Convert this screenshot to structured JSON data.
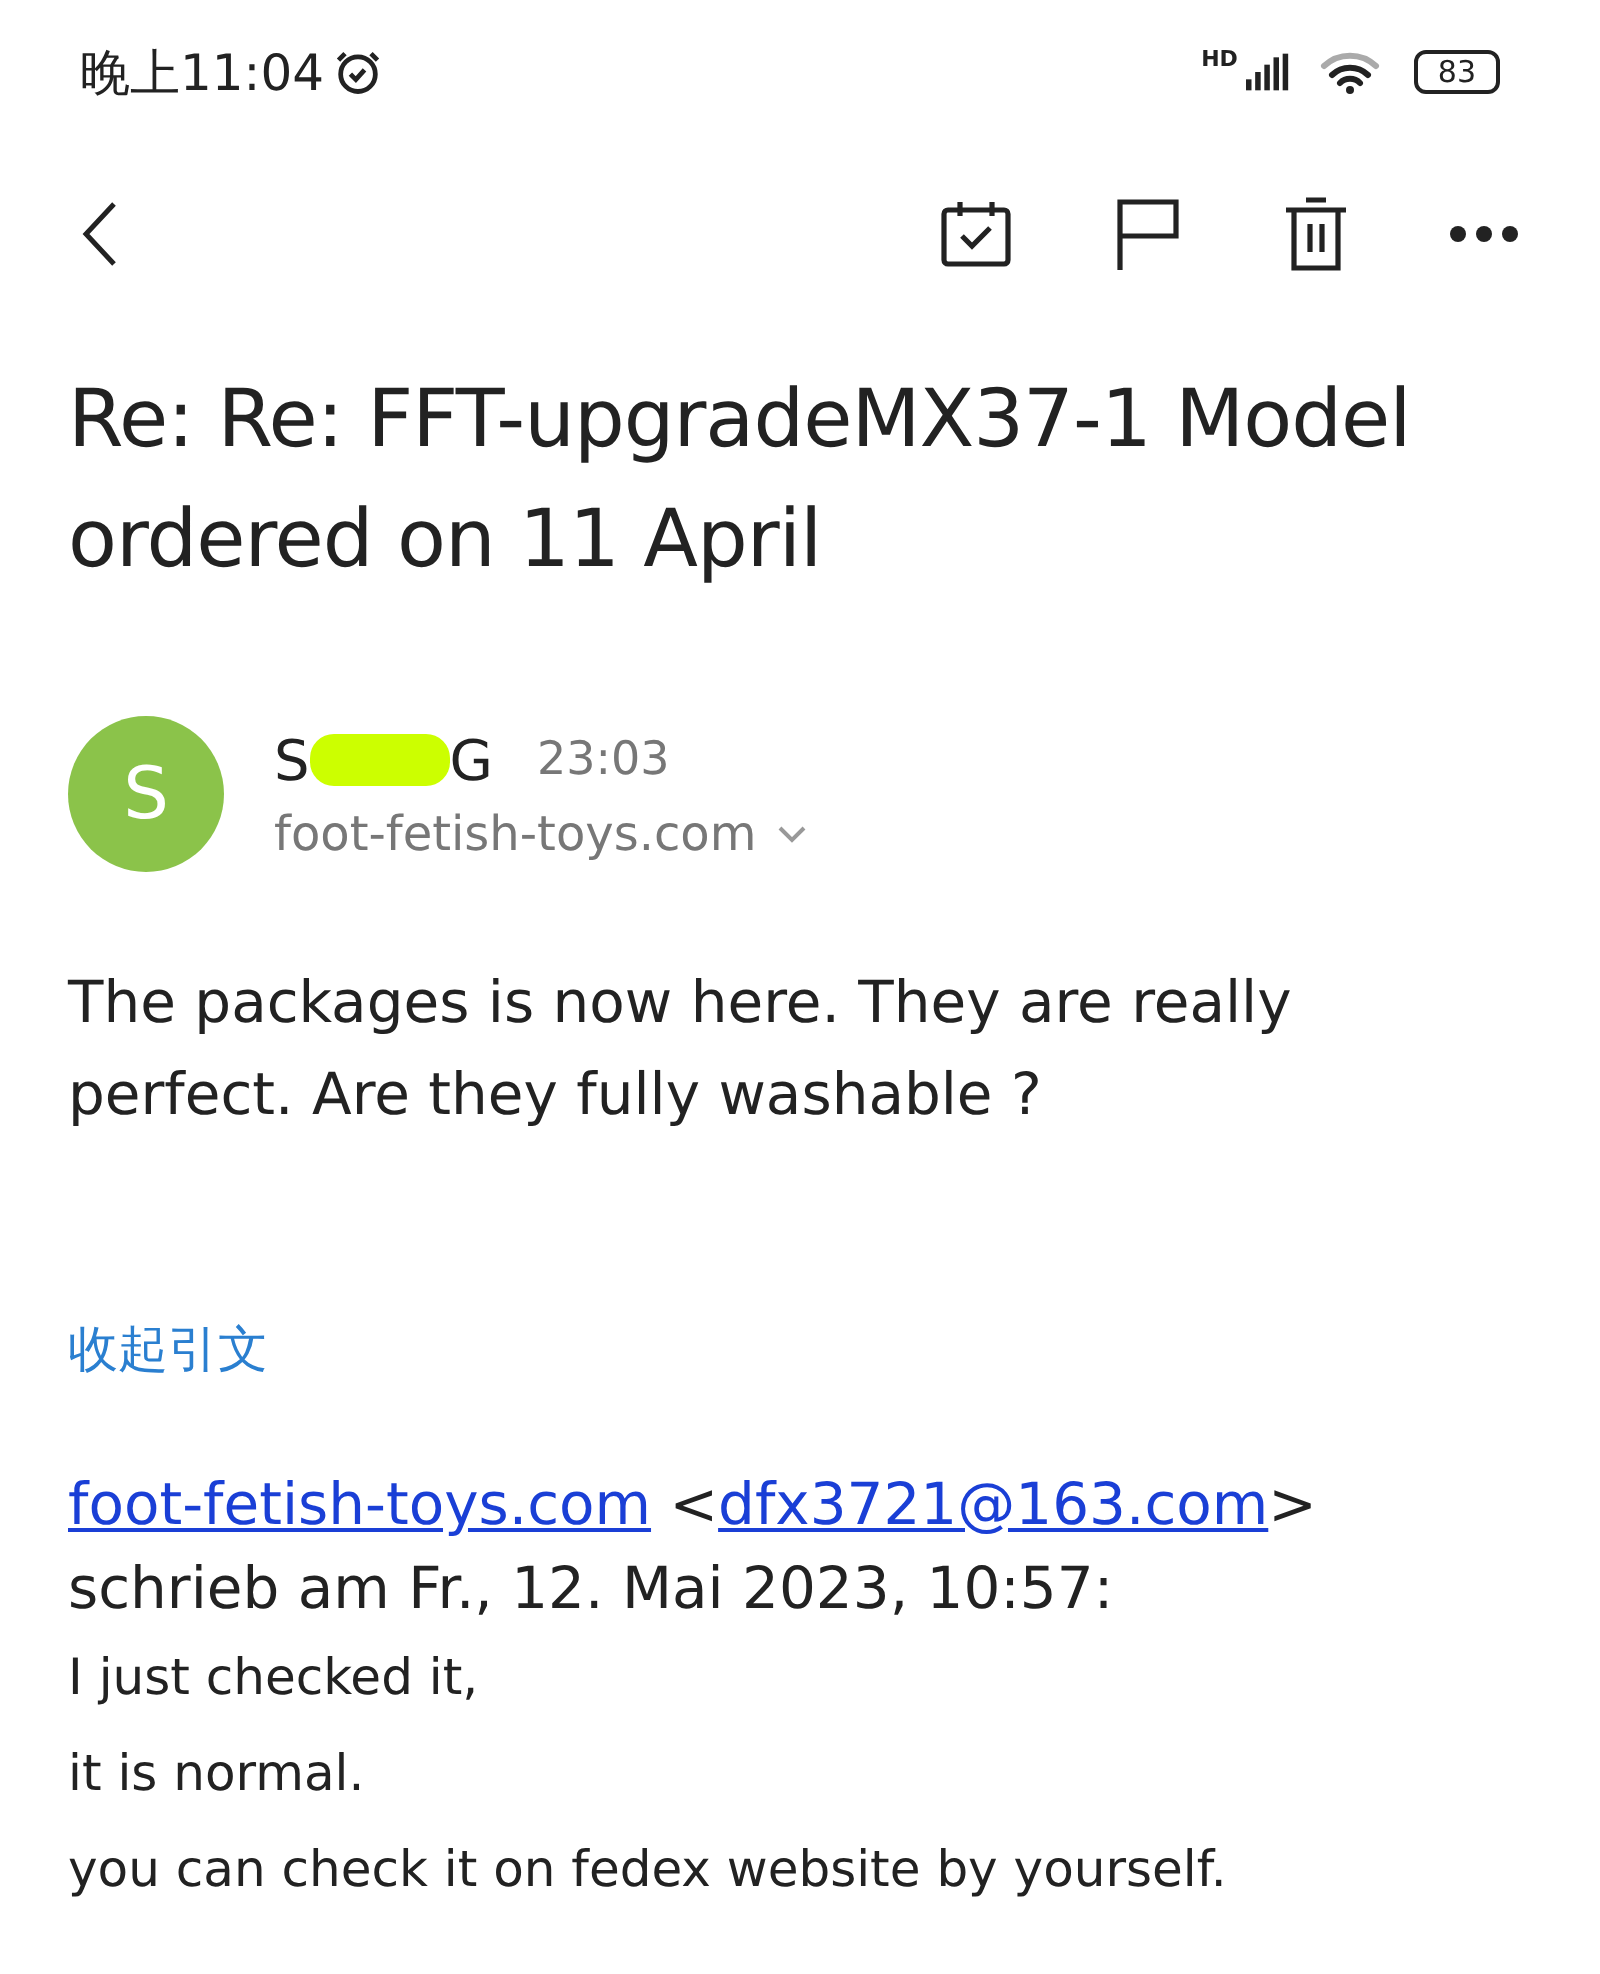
{
  "status_bar": {
    "time": "晚上11:04",
    "network": "HD",
    "battery": "83"
  },
  "subject": "Re: Re: FFT-upgradeMX37-1 Model ordered on 11 April",
  "sender": {
    "avatar": "S",
    "name_start": "S",
    "name_end": "G",
    "redacted": true,
    "time": "23:03",
    "address": "foot-fetish-toys.com"
  },
  "body": "The packages is now here. They are really perfect. Are they fully washable ?",
  "collapse_quote": "收起引文",
  "quote": {
    "link_name": "foot-fetish-toys.com",
    "open": "<",
    "email": "dfx3721@163.com",
    "close": ">",
    "date_line": "schrieb am Fr., 12. Mai 2023, 10:57:",
    "lines": [
      "I just checked it,",
      "it is normal.",
      "you can check it on fedex website by yourself."
    ]
  }
}
